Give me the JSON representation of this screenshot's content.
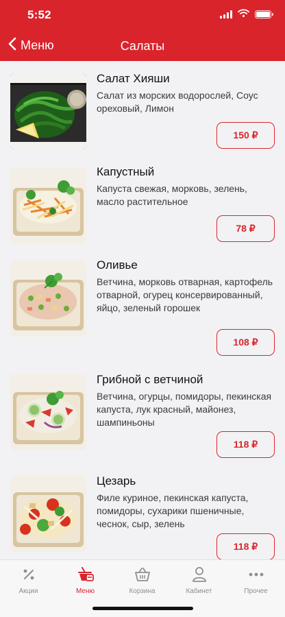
{
  "status_bar": {
    "time": "5:52"
  },
  "nav": {
    "back_label": "Меню",
    "title": "Салаты"
  },
  "items": [
    {
      "name": "Салат Хияши",
      "description": "Салат из морских водорослей, Соус ореховый, Лимон",
      "price": "150 ₽"
    },
    {
      "name": "Капустный",
      "description": "Капуста свежая, морковь, зелень, масло растительное",
      "price": "78 ₽"
    },
    {
      "name": "Оливье",
      "description": "Ветчина, морковь отварная, картофель отварной, огурец консервированный, яйцо, зеленый горошек",
      "price": "108 ₽"
    },
    {
      "name": "Грибной с ветчиной",
      "description": "Ветчина, огурцы, помидоры, пекинская капуста, лук красный, майонез, шампиньоны",
      "price": "118 ₽"
    },
    {
      "name": "Цезарь",
      "description": "Филе куриное, пекинская капуста, помидоры, сухарики пшеничные, чеснок, сыр, зелень",
      "price": "118 ₽"
    }
  ],
  "tabbar": {
    "tabs": [
      {
        "label": "Акции",
        "icon": "percent-icon"
      },
      {
        "label": "Меню",
        "icon": "menu-dish-icon",
        "active": true
      },
      {
        "label": "Корзина",
        "icon": "basket-icon"
      },
      {
        "label": "Кабинет",
        "icon": "person-icon"
      },
      {
        "label": "Прочее",
        "icon": "more-dots-icon"
      }
    ]
  },
  "colors": {
    "accent": "#d9242c",
    "background": "#f2f2f4",
    "tab_inactive": "#8e8e93"
  }
}
